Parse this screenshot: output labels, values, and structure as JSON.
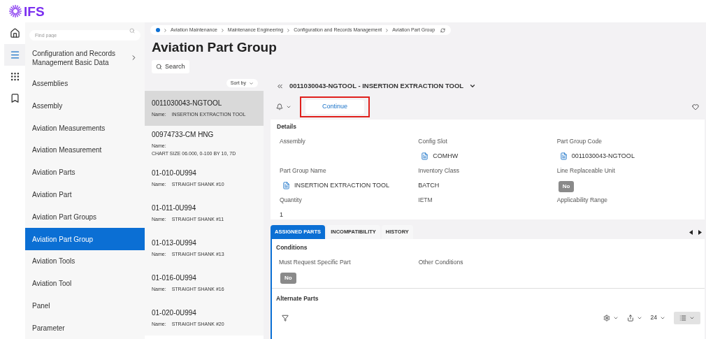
{
  "app": {
    "logo": "IFS"
  },
  "rail": [
    {
      "selected": false
    },
    {
      "selected": true
    },
    {
      "selected": false
    },
    {
      "selected": false
    }
  ],
  "nav": {
    "search_placeholder": "Find page",
    "items": [
      {
        "label": "Configuration and Records Management Basic Data",
        "has_children": true,
        "selected": false
      },
      {
        "label": "Assemblies",
        "has_children": false,
        "selected": false
      },
      {
        "label": "Assembly",
        "has_children": false,
        "selected": false
      },
      {
        "label": "Aviation Measurements",
        "has_children": false,
        "selected": false
      },
      {
        "label": "Aviation Measurement",
        "has_children": false,
        "selected": false
      },
      {
        "label": "Aviation Parts",
        "has_children": false,
        "selected": false
      },
      {
        "label": "Aviation Part",
        "has_children": false,
        "selected": false
      },
      {
        "label": "Aviation Part Groups",
        "has_children": false,
        "selected": false
      },
      {
        "label": "Aviation Part Group",
        "has_children": false,
        "selected": true
      },
      {
        "label": "Aviation Tools",
        "has_children": false,
        "selected": false
      },
      {
        "label": "Aviation Tool",
        "has_children": false,
        "selected": false
      },
      {
        "label": "Panel",
        "has_children": false,
        "selected": false
      },
      {
        "label": "Parameter",
        "has_children": false,
        "selected": false
      }
    ]
  },
  "breadcrumb": [
    "Aviation Maintenance",
    "Maintenance Engineering",
    "Configuration and Records Management",
    "Aviation Part Group"
  ],
  "page_title": "Aviation Part Group",
  "search_button": "Search",
  "list": {
    "sort_label": "Sort by",
    "records": [
      {
        "code": "0011030043-NGTOOL",
        "name_label": "Name:",
        "name": "INSERTION EXTRACTION TOOL",
        "selected": true
      },
      {
        "code": "00974733-CM HNG",
        "name_label": "Name:",
        "name": "CHART SIZE 06.000, 0-100 BY 10, 7D",
        "selected": false
      },
      {
        "code": "01-010-0U994",
        "name_label": "Name:",
        "name": "STRAIGHT SHANK #10",
        "selected": false
      },
      {
        "code": "01-011-0U994",
        "name_label": "Name:",
        "name": "STRAIGHT SHANK #11",
        "selected": false
      },
      {
        "code": "01-013-0U994",
        "name_label": "Name:",
        "name": "STRAIGHT SHANK #13",
        "selected": false
      },
      {
        "code": "01-016-0U994",
        "name_label": "Name:",
        "name": "STRAIGHT SHANK #16",
        "selected": false
      },
      {
        "code": "01-020-0U994",
        "name_label": "Name:",
        "name": "STRAIGHT SHANK #20",
        "selected": false
      }
    ]
  },
  "record": {
    "title": "0011030043-NGTOOL - INSERTION EXTRACTION TOOL",
    "continue_button": {
      "label": "Continue",
      "highlighted": true
    },
    "details": {
      "heading": "Details",
      "fields": [
        {
          "label": "Assembly"
        },
        {
          "label": "Config Slot",
          "value": "COMHW",
          "kind": "link"
        },
        {
          "label": "Part Group Code",
          "value": "0011030043-NGTOOL",
          "kind": "link"
        },
        {
          "label": "Part Group Name",
          "value": "INSERTION EXTRACTION TOOL",
          "kind": "link"
        },
        {
          "label": "Inventory Class",
          "value": "BATCH",
          "kind": "text"
        },
        {
          "label": "Line Replaceable Unit",
          "value": "No",
          "kind": "badge"
        },
        {
          "label": "Quantity",
          "value": "1",
          "kind": "text"
        },
        {
          "label": "IETM"
        },
        {
          "label": "Applicability Range"
        }
      ]
    }
  },
  "tabs": [
    {
      "label": "ASSIGNED PARTS",
      "selected": true
    },
    {
      "label": "INCOMPATIBILITY",
      "selected": false
    },
    {
      "label": "HISTORY",
      "selected": false
    }
  ],
  "conditions": {
    "heading": "Conditions",
    "fields": [
      {
        "label": "Must Request Specific Part",
        "value": "No",
        "kind": "badge"
      },
      {
        "label": "Other Conditions"
      }
    ]
  },
  "alternate_parts": {
    "heading": "Alternate Parts",
    "page_size": "24"
  }
}
